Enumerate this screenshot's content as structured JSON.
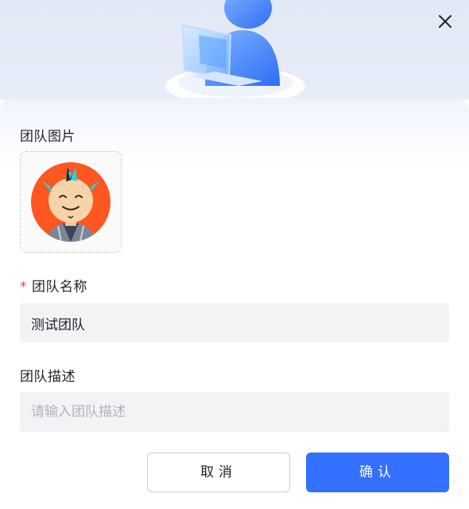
{
  "dialog": {
    "banner_icon": "team-illustration-icon",
    "close_icon": "close-icon"
  },
  "form": {
    "picture_label": "团队图片",
    "avatar_icon": "team-avatar-icon",
    "name_required_mark": "*",
    "name_label": "团队名称",
    "name_value": "测试团队",
    "description_label": "团队描述",
    "description_value": "",
    "description_placeholder": "请输入团队描述"
  },
  "footer": {
    "cancel_label": "取消",
    "confirm_label": "确认"
  },
  "colors": {
    "primary": "#3370ff",
    "required": "#f53f3f",
    "input_bg": "#f2f3f5",
    "avatar_bg": "#ff5722"
  }
}
